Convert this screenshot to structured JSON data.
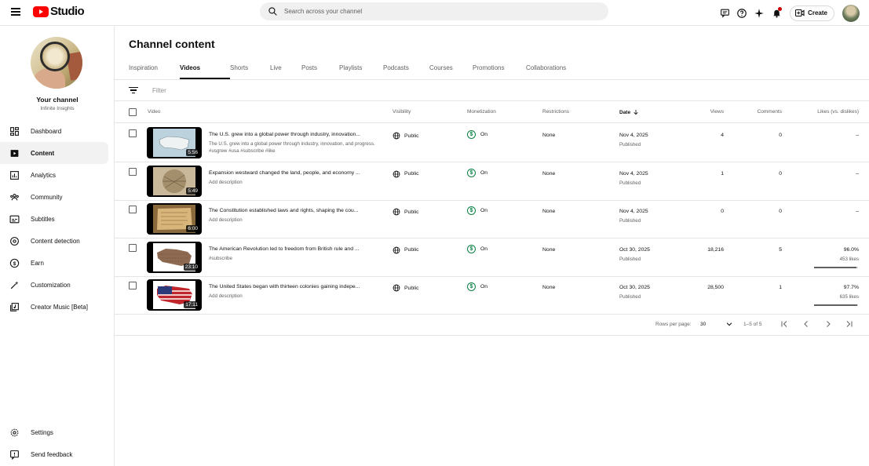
{
  "header": {
    "logo_text": "Studio",
    "search_placeholder": "Search across your channel",
    "create_label": "Create"
  },
  "sidebar": {
    "channel_title": "Your channel",
    "channel_name": "Infinite Insights",
    "items": [
      {
        "label": "Dashboard",
        "icon": "dashboard-icon"
      },
      {
        "label": "Content",
        "icon": "content-icon",
        "active": true
      },
      {
        "label": "Analytics",
        "icon": "analytics-icon"
      },
      {
        "label": "Community",
        "icon": "community-icon"
      },
      {
        "label": "Subtitles",
        "icon": "subtitles-icon"
      },
      {
        "label": "Content detection",
        "icon": "content-detection-icon"
      },
      {
        "label": "Earn",
        "icon": "earn-icon"
      },
      {
        "label": "Customization",
        "icon": "customization-icon"
      },
      {
        "label": "Creator Music [Beta]",
        "icon": "creator-music-icon"
      }
    ],
    "bottom_items": [
      {
        "label": "Settings",
        "icon": "settings-icon"
      },
      {
        "label": "Send feedback",
        "icon": "feedback-icon"
      }
    ]
  },
  "main": {
    "title": "Channel content",
    "tabs": [
      "Inspiration",
      "Videos",
      "Shorts",
      "Live",
      "Posts",
      "Playlists",
      "Podcasts",
      "Courses",
      "Promotions",
      "Collaborations"
    ],
    "active_tab": "Videos",
    "filter_placeholder": "Filter",
    "columns": {
      "video": "Video",
      "visibility": "Visibility",
      "monetization": "Monetization",
      "restrictions": "Restrictions",
      "date": "Date",
      "views": "Views",
      "comments": "Comments",
      "likes": "Likes (vs. dislikes)"
    },
    "rows": [
      {
        "duration": "5:56",
        "title": "The U.S. grew into a global power through industry, innovation...",
        "description": "The U.S. grew into a global power through industry, innovation, and progress. #usgrew #usa #subscribe #like",
        "visibility": "Public",
        "monetization": "On",
        "restrictions": "None",
        "date": "Nov 4, 2025",
        "status": "Published",
        "views": "4",
        "comments": "0",
        "likes": "–",
        "likes_count": ""
      },
      {
        "duration": "5:49",
        "title": "Expansion westward changed the land, people, and economy ...",
        "description": "Add description",
        "visibility": "Public",
        "monetization": "On",
        "restrictions": "None",
        "date": "Nov 4, 2025",
        "status": "Published",
        "views": "1",
        "comments": "0",
        "likes": "–",
        "likes_count": ""
      },
      {
        "duration": "6:00",
        "title": "The Constitution established laws and rights, shaping the cou...",
        "description": "Add description",
        "visibility": "Public",
        "monetization": "On",
        "restrictions": "None",
        "date": "Nov 4, 2025",
        "status": "Published",
        "views": "0",
        "comments": "0",
        "likes": "–",
        "likes_count": ""
      },
      {
        "duration": "23:10",
        "title": "The American Revolution led to freedom from British rule and ...",
        "description": "#subscribe",
        "visibility": "Public",
        "monetization": "On",
        "restrictions": "None",
        "date": "Oct 30, 2025",
        "status": "Published",
        "views": "18,216",
        "comments": "5",
        "likes": "96.0%",
        "likes_count": "453 likes",
        "likes_ratio": 0.96
      },
      {
        "duration": "17:11",
        "title": "The United States began with thirteen colonies gaining indepe...",
        "description": "Add description",
        "visibility": "Public",
        "monetization": "On",
        "restrictions": "None",
        "date": "Oct 30, 2025",
        "status": "Published",
        "views": "28,500",
        "comments": "1",
        "likes": "97.7%",
        "likes_count": "635 likes",
        "likes_ratio": 0.977
      }
    ],
    "pager": {
      "rows_label": "Rows per page:",
      "rows_value": "30",
      "range": "1–5 of 5"
    }
  },
  "colors": {
    "brand_red": "#ff0000",
    "monetization_green": "#0b8043",
    "notification_red": "#cc0000"
  }
}
